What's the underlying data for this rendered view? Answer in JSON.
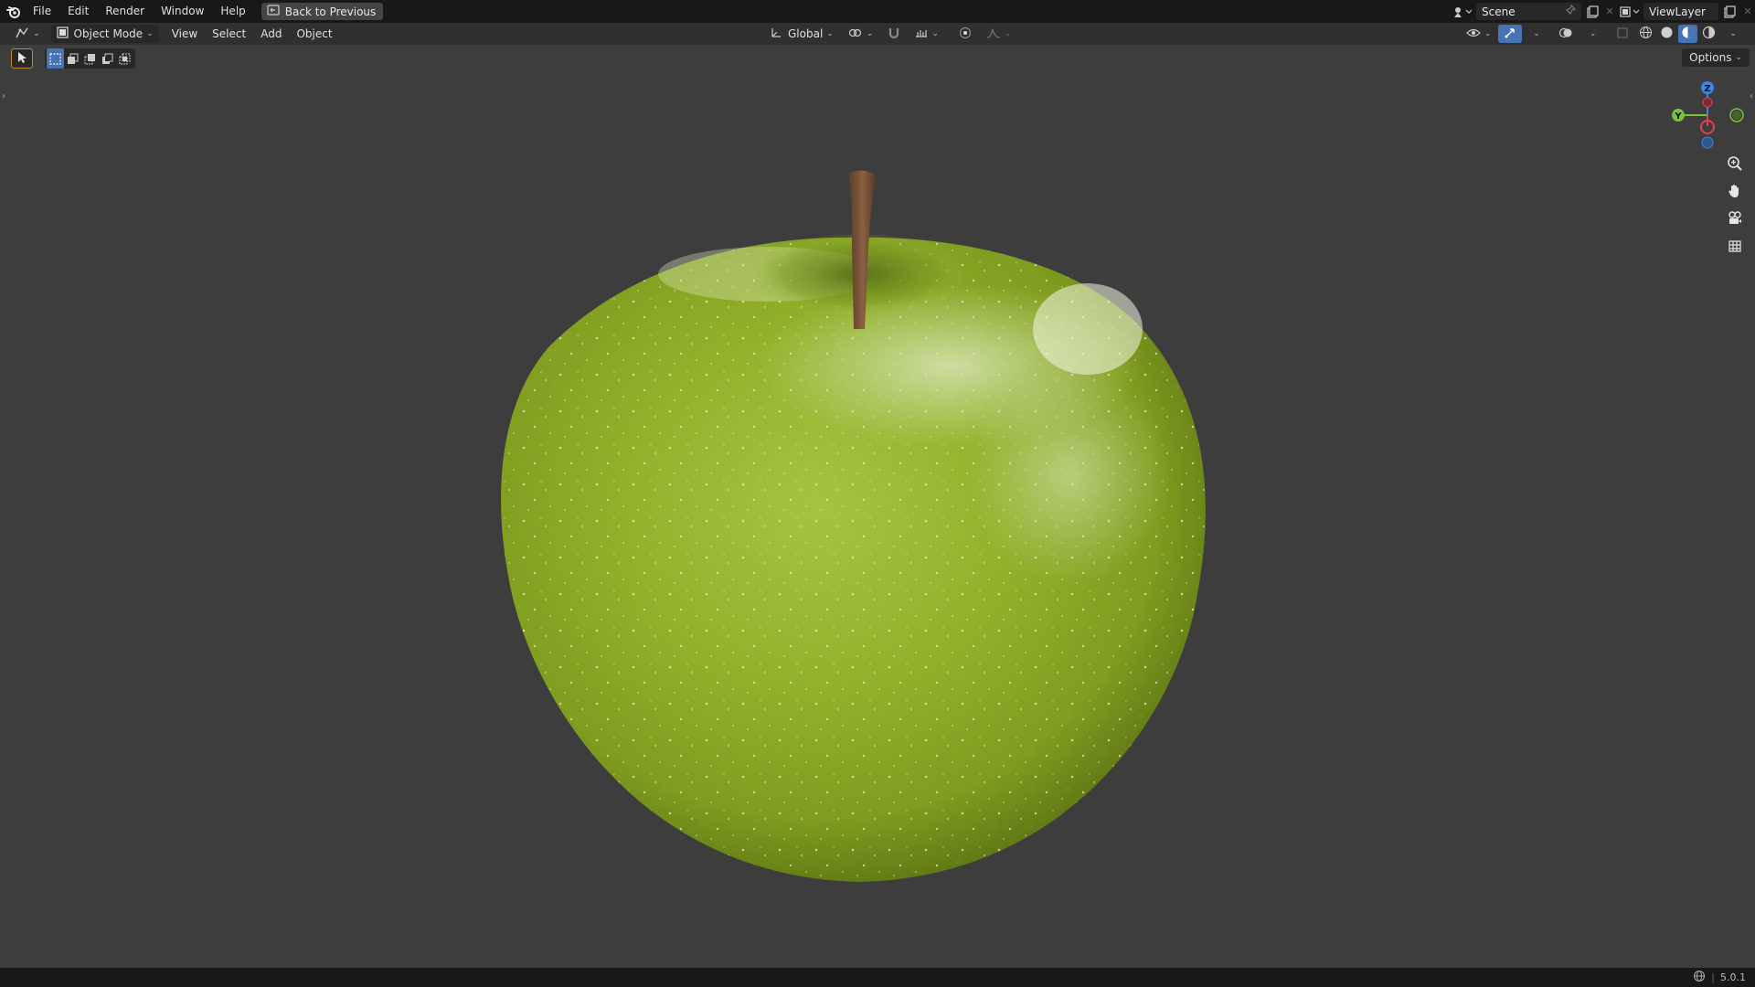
{
  "topbar": {
    "menus": [
      "File",
      "Edit",
      "Render",
      "Window",
      "Help"
    ],
    "back_label": "Back to Previous",
    "scene_label": "Scene",
    "view_layer_label": "ViewLayer"
  },
  "header": {
    "mode_label": "Object Mode",
    "menus": [
      "View",
      "Select",
      "Add",
      "Object"
    ],
    "orientation_label": "Global"
  },
  "viewport": {
    "options_label": "Options",
    "gizmo_axes": [
      "Z",
      "Y"
    ],
    "object": "apple-model"
  },
  "statusbar": {
    "version": "5.0.1"
  },
  "colors": {
    "topbar_bg": "#181818",
    "header_bg": "#303030",
    "viewport_bg": "#3d3d3d",
    "axis_x": "#e0414c",
    "axis_y": "#7ac23b",
    "axis_z": "#3a86e6",
    "apple_green": "#8fb22a",
    "stem_brown": "#7a5236"
  }
}
